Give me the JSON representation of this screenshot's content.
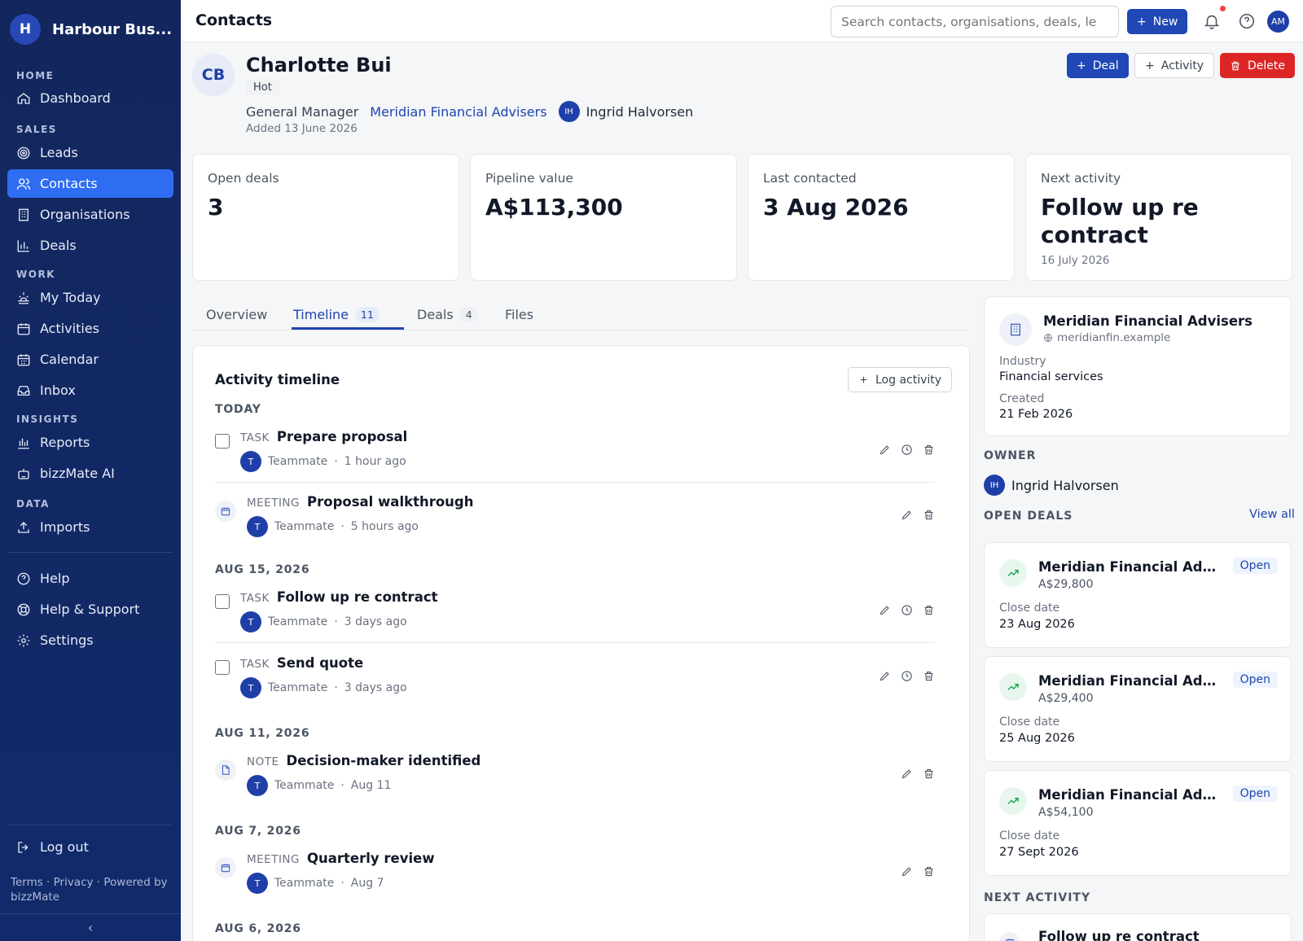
{
  "sidebar": {
    "brand_initial": "H",
    "brand_name": "Harbour Bus...",
    "sections": {
      "home": "HOME",
      "sales": "SALES",
      "work": "WORK",
      "insights": "INSIGHTS",
      "data": "DATA"
    },
    "items": {
      "dashboard": "Dashboard",
      "leads": "Leads",
      "contacts": "Contacts",
      "organisations": "Organisations",
      "deals": "Deals",
      "my_today": "My Today",
      "activities": "Activities",
      "calendar": "Calendar",
      "inbox": "Inbox",
      "reports": "Reports",
      "bizzmate_ai": "bizzMate AI",
      "imports": "Imports",
      "help": "Help",
      "help_support": "Help & Support",
      "settings": "Settings",
      "logout": "Log out"
    },
    "footer": "Terms · Privacy · Powered by bizzMate",
    "collapse": "‹"
  },
  "topbar": {
    "title": "Contacts",
    "search_placeholder": "Search contacts, organisations, deals, le",
    "new_label": "New",
    "avatar": "AM"
  },
  "contact": {
    "initials": "CB",
    "name": "Charlotte Bui",
    "badge": "Hot",
    "role": "General Manager",
    "org": "Meridian Financial Advisers",
    "owner_initials": "IH",
    "owner": "Ingrid Halvorsen",
    "added": "Added 13 June 2026",
    "buttons": {
      "deal": "Deal",
      "activity": "Activity",
      "delete": "Delete"
    }
  },
  "stats": [
    {
      "label": "Open deals",
      "value": "3",
      "sub": ""
    },
    {
      "label": "Pipeline value",
      "value": "A$113,300",
      "sub": ""
    },
    {
      "label": "Last contacted",
      "value": "3 Aug 2026",
      "sub": ""
    },
    {
      "label": "Next activity",
      "value": "Follow up re contract",
      "sub": "16 July 2026"
    }
  ],
  "tabs": [
    {
      "label": "Overview",
      "count": ""
    },
    {
      "label": "Timeline",
      "count": "11"
    },
    {
      "label": "Deals",
      "count": "4"
    },
    {
      "label": "Files",
      "count": ""
    }
  ],
  "timeline": {
    "title": "Activity timeline",
    "log_label": "Log activity",
    "groups": [
      "TODAY",
      "AUG 15, 2026",
      "AUG 11, 2026",
      "AUG 7, 2026",
      "AUG 6, 2026"
    ],
    "items": [
      {
        "type": "TASK",
        "name": "Prepare proposal",
        "who": "Teammate",
        "when": "1 hour ago",
        "avatar": "T"
      },
      {
        "type": "MEETING",
        "name": "Proposal walkthrough",
        "who": "Teammate",
        "when": "5 hours ago",
        "avatar": "T"
      },
      {
        "type": "TASK",
        "name": "Follow up re contract",
        "who": "Teammate",
        "when": "3 days ago",
        "avatar": "T"
      },
      {
        "type": "TASK",
        "name": "Send quote",
        "who": "Teammate",
        "when": "3 days ago",
        "avatar": "T"
      },
      {
        "type": "NOTE",
        "name": "Decision-maker identified",
        "who": "Teammate",
        "when": "Aug 11",
        "avatar": "T"
      },
      {
        "type": "MEETING",
        "name": "Quarterly review",
        "who": "Teammate",
        "when": "Aug 7",
        "avatar": "T"
      }
    ],
    "dot": "·"
  },
  "org_card": {
    "name": "Meridian Financial Advisers",
    "domain": "meridianfin.example",
    "industry_label": "Industry",
    "industry": "Financial services",
    "created_label": "Created",
    "created": "21 Feb 2026"
  },
  "owner_section": {
    "heading": "OWNER",
    "initials": "IH",
    "name": "Ingrid Halvorsen"
  },
  "open_deals": {
    "heading": "OPEN DEALS",
    "view_all": "View all",
    "close_label": "Close date",
    "deals": [
      {
        "name": "Meridian Financial Advi...",
        "amount": "A$29,800",
        "status": "Open",
        "close": "23 Aug 2026"
      },
      {
        "name": "Meridian Financial Advi...",
        "amount": "A$29,400",
        "status": "Open",
        "close": "25 Aug 2026"
      },
      {
        "name": "Meridian Financial Advi...",
        "amount": "A$54,100",
        "status": "Open",
        "close": "27 Sept 2026"
      }
    ]
  },
  "next_activity": {
    "heading": "NEXT ACTIVITY",
    "name": "Follow up re contract"
  }
}
